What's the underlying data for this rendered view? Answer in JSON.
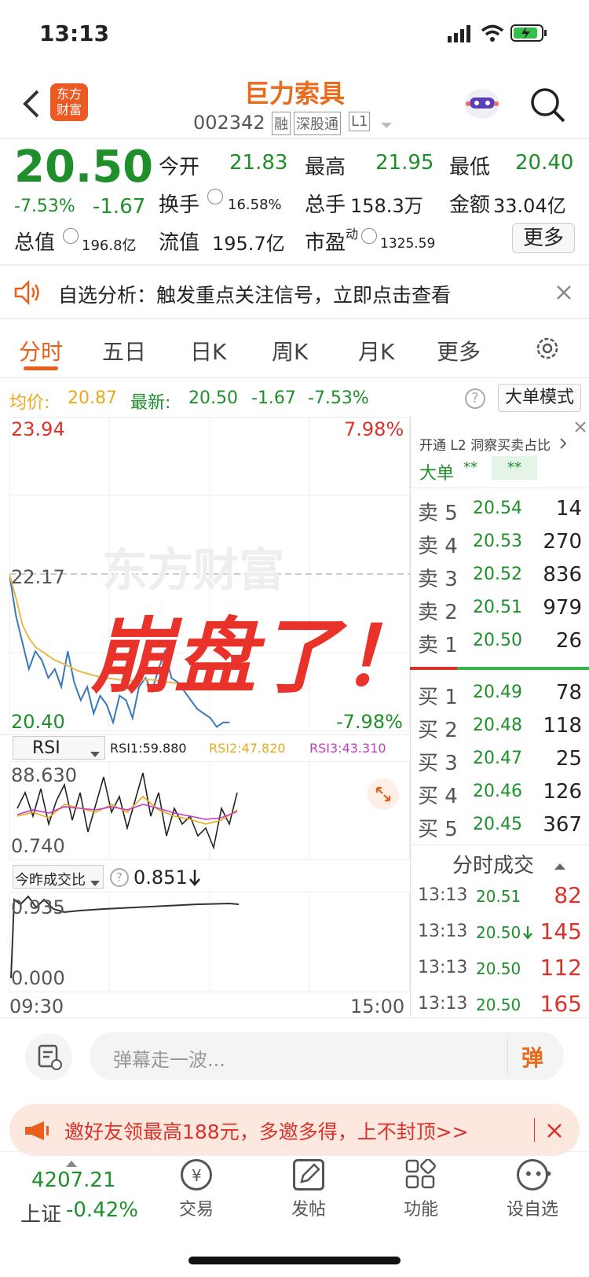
{
  "status_bar": {
    "time": "13:13"
  },
  "header": {
    "logo_text_1": "东方",
    "logo_text_2": "财富",
    "stock_name": "巨力索具",
    "stock_code": "002342",
    "tags": [
      "融",
      "深股通",
      "L1"
    ]
  },
  "quote": {
    "price": "20.50",
    "change_pct": "-7.53%",
    "change": "-1.67",
    "fields": [
      {
        "label": "今开",
        "value": "21.83"
      },
      {
        "label": "最高",
        "value": "21.95"
      },
      {
        "label": "最低",
        "value": "20.40"
      },
      {
        "label": "换手",
        "value": "16.58%"
      },
      {
        "label": "总手",
        "value": "158.3万"
      },
      {
        "label": "金额",
        "value": "33.04亿"
      },
      {
        "label": "总值",
        "value": "196.8亿"
      },
      {
        "label": "流值",
        "value": "195.7亿"
      },
      {
        "label": "市盈",
        "sup": "动",
        "value": "1325.59"
      }
    ],
    "more_label": "更多"
  },
  "notice": {
    "text": "自选分析：触发重点关注信号，立即点击查看"
  },
  "tabs": [
    "分时",
    "五日",
    "日K",
    "周K",
    "月K",
    "更多"
  ],
  "info_line": {
    "avg_label": "均价:",
    "avg_value": "20.87",
    "latest_label": "最新:",
    "latest_value": "20.50",
    "change": "-1.67",
    "change_pct": "-7.53%",
    "big_order_mode": "大单模式"
  },
  "chart": {
    "y_high": "23.94",
    "y_mid": "22.17",
    "y_low": "20.40",
    "pct_high": "7.98%",
    "pct_low": "-7.98%",
    "watermark": "东方财富",
    "overlay_text": "崩盘了！",
    "x_start": "09:30",
    "x_end": "15:00"
  },
  "chart_data": {
    "type": "line",
    "series": [
      {
        "values": [
          22.17,
          21.7,
          21.4,
          21.1,
          21.3,
          21.2,
          21.0,
          21.1,
          20.9,
          21.3,
          20.95,
          20.75,
          20.9,
          20.6,
          20.8,
          20.7,
          20.5,
          20.8,
          20.75,
          20.55,
          20.9,
          21.0,
          20.85,
          21.1,
          21.3,
          21.0,
          20.95,
          20.85,
          20.75,
          20.65,
          20.6,
          20.55,
          20.45,
          20.5,
          20.5
        ]
      },
      {
        "values": [
          22.17,
          21.9,
          21.6,
          21.45,
          21.35,
          21.3,
          21.25,
          21.2,
          21.17,
          21.14,
          21.1,
          21.07,
          21.05,
          21.03,
          21.01,
          21.0,
          20.99,
          20.98,
          20.97,
          20.97,
          20.98,
          20.98,
          20.98,
          20.97,
          20.96,
          20.95,
          20.94,
          20.93,
          20.92,
          20.91,
          20.9,
          20.89,
          20.88,
          20.87,
          20.87
        ]
      }
    ],
    "ylim": [
      20.4,
      23.94
    ]
  },
  "rsi": {
    "label": "RSI",
    "rsi1": "RSI1:59.880",
    "rsi2": "RSI2:47.820",
    "rsi3": "RSI3:43.310",
    "top": "88.630",
    "bottom": "0.740"
  },
  "ratio": {
    "label": "今昨成交比",
    "value": "0.851",
    "top": "0.935",
    "bottom": "0.000"
  },
  "orderbook": {
    "l2_text": "开通 L2 洞察买卖占比",
    "big_label": "大单",
    "stars1": "**",
    "stars2": "**",
    "sells": [
      {
        "label": "卖 5",
        "price": "20.54",
        "vol": "14"
      },
      {
        "label": "卖 4",
        "price": "20.53",
        "vol": "270"
      },
      {
        "label": "卖 3",
        "price": "20.52",
        "vol": "836"
      },
      {
        "label": "卖 2",
        "price": "20.51",
        "vol": "979"
      },
      {
        "label": "卖 1",
        "price": "20.50",
        "vol": "26"
      }
    ],
    "buys": [
      {
        "label": "买 1",
        "price": "20.49",
        "vol": "78"
      },
      {
        "label": "买 2",
        "price": "20.48",
        "vol": "118"
      },
      {
        "label": "买 3",
        "price": "20.47",
        "vol": "25"
      },
      {
        "label": "买 4",
        "price": "20.46",
        "vol": "126"
      },
      {
        "label": "买 5",
        "price": "20.45",
        "vol": "367"
      }
    ],
    "deals_title": "分时成交",
    "deals": [
      {
        "time": "13:13",
        "price": "20.51",
        "vol": "82"
      },
      {
        "time": "13:13",
        "price": "20.50",
        "vol": "145"
      },
      {
        "time": "13:13",
        "price": "20.50",
        "vol": "112"
      },
      {
        "time": "13:13",
        "price": "20.50",
        "vol": "165"
      }
    ]
  },
  "comment": {
    "placeholder": "弹幕走一波...",
    "send": "弹"
  },
  "promo": {
    "text": "邀好友领最高188元，多邀多得，上不封顶>>"
  },
  "bottom_nav": {
    "index_value": "4207.21",
    "index_label": "上证",
    "index_change": "-0.42%",
    "items": [
      "交易",
      "发帖",
      "功能",
      "设自选"
    ]
  }
}
